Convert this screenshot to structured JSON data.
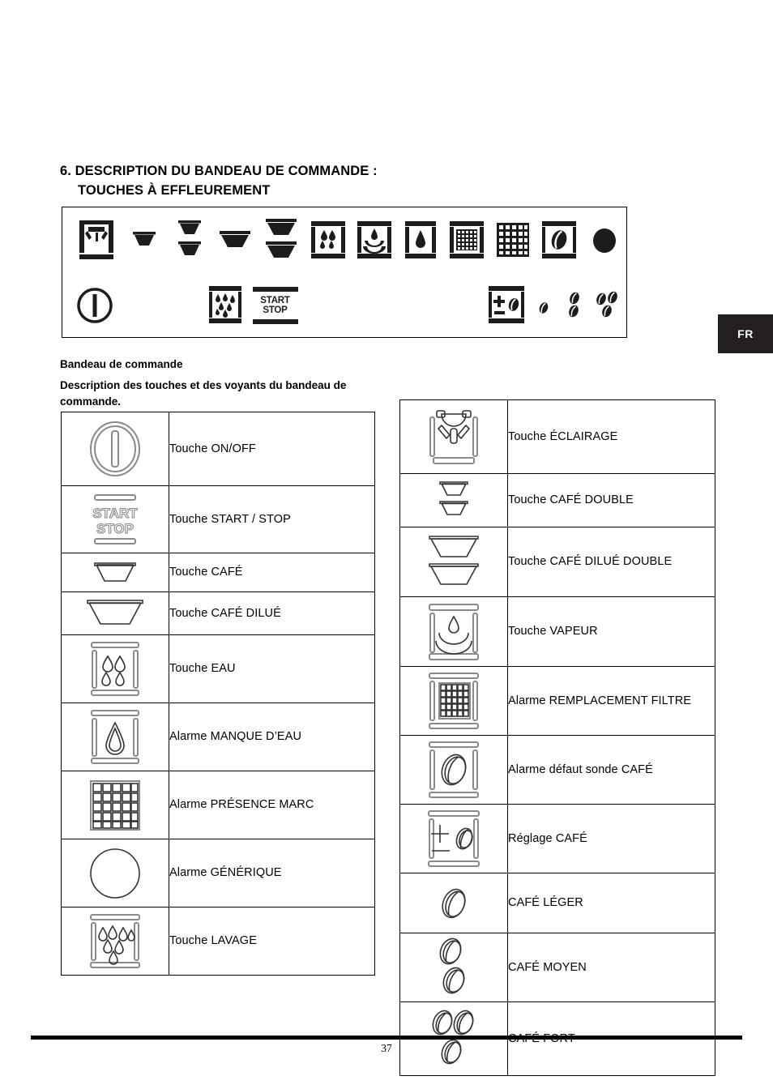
{
  "page": {
    "number": "37",
    "language_tab": "FR"
  },
  "heading": {
    "line1": "6. DESCRIPTION DU BANDEAU DE COMMANDE :",
    "line2": "TOUCHES À EFFLEUREMENT"
  },
  "intro": {
    "title": "Bandeau de commande",
    "body": "Description des touches et des voyants du bandeau de commande."
  },
  "control_panel": {
    "row1_icons": [
      "light-icon",
      "coffee-cup-icon",
      "coffee-double-cup-icon",
      "coffee-diluted-cup-icon",
      "coffee-diluted-double-cup-icon",
      "wash-droplets-icon",
      "steam-icon",
      "water-drop-icon",
      "filter-grid-icon",
      "marc-grid-icon",
      "coffee-bean-icon",
      "generic-alarm-dot-icon"
    ],
    "row2_icons": [
      "power-onoff-icon",
      "rinse-droplets-icon",
      "start-stop-icon",
      "coffee-adjust-icon",
      "bean-light-icon",
      "bean-medium-icon",
      "bean-strong-icon"
    ],
    "start_stop_label_line1": "START",
    "start_stop_label_line2": "STOP"
  },
  "table_left": {
    "rows": [
      {
        "icon": "power-onoff-icon",
        "label": "Touche ON/OFF"
      },
      {
        "icon": "start-stop-icon",
        "label": "Touche START / STOP"
      },
      {
        "icon": "coffee-cup-icon",
        "label": "Touche CAFÉ"
      },
      {
        "icon": "coffee-diluted-cup-icon",
        "label": "Touche CAFÉ DILUÉ"
      },
      {
        "icon": "water-droplets-icon",
        "label": "Touche EAU"
      },
      {
        "icon": "water-drop-icon",
        "label": "Alarme MANQUE D’EAU"
      },
      {
        "icon": "marc-grid-icon",
        "label": "Alarme PRÉSENCE MARC"
      },
      {
        "icon": "generic-alarm-circle-icon",
        "label": "Alarme GÉNÉRIQUE"
      },
      {
        "icon": "rinse-droplets-icon",
        "label": "Touche LAVAGE"
      }
    ]
  },
  "table_right": {
    "rows": [
      {
        "icon": "light-icon",
        "label": "Touche ÉCLAIRAGE"
      },
      {
        "icon": "coffee-double-cup-icon",
        "label": "Touche CAFÉ DOUBLE"
      },
      {
        "icon": "coffee-diluted-double-cup-icon",
        "label": "Touche CAFÉ DILUÉ DOUBLE"
      },
      {
        "icon": "steam-icon",
        "label": "Touche VAPEUR"
      },
      {
        "icon": "filter-grid-icon",
        "label": "Alarme REMPLACEMENT FILTRE"
      },
      {
        "icon": "coffee-bean-icon",
        "label": "Alarme défaut sonde CAFÉ"
      },
      {
        "icon": "coffee-adjust-icon",
        "label": "Réglage CAFÉ"
      },
      {
        "icon": "bean-light-icon",
        "label": "CAFÉ LÉGER"
      },
      {
        "icon": "bean-medium-icon",
        "label": "CAFÉ MOYEN"
      },
      {
        "icon": "bean-strong-icon",
        "label": "CAFÉ FORT"
      }
    ]
  },
  "colors": {
    "ink": "#000000",
    "icon_solid": "#1c1c1c",
    "icon_outline": "#8a8a8a",
    "tab_background": "#231f20",
    "tab_text": "#ffffff"
  }
}
